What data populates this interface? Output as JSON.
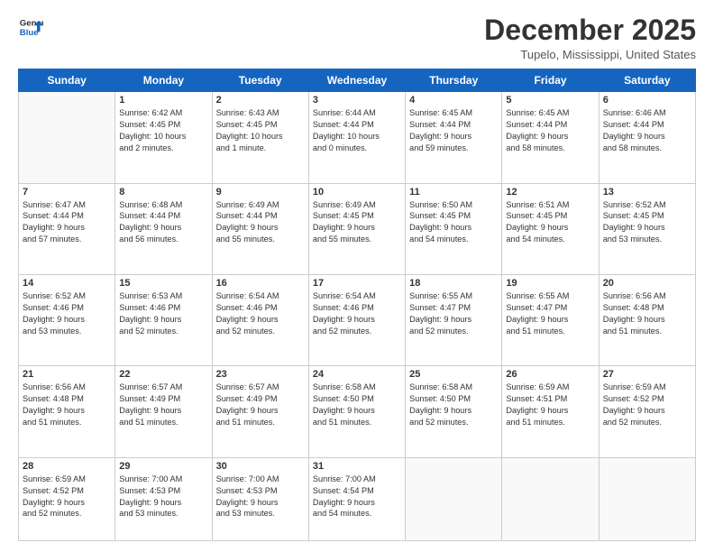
{
  "header": {
    "logo_line1": "General",
    "logo_line2": "Blue",
    "month_title": "December 2025",
    "location": "Tupelo, Mississippi, United States"
  },
  "weekdays": [
    "Sunday",
    "Monday",
    "Tuesday",
    "Wednesday",
    "Thursday",
    "Friday",
    "Saturday"
  ],
  "weeks": [
    [
      {
        "day": "",
        "info": ""
      },
      {
        "day": "1",
        "info": "Sunrise: 6:42 AM\nSunset: 4:45 PM\nDaylight: 10 hours\nand 2 minutes."
      },
      {
        "day": "2",
        "info": "Sunrise: 6:43 AM\nSunset: 4:45 PM\nDaylight: 10 hours\nand 1 minute."
      },
      {
        "day": "3",
        "info": "Sunrise: 6:44 AM\nSunset: 4:44 PM\nDaylight: 10 hours\nand 0 minutes."
      },
      {
        "day": "4",
        "info": "Sunrise: 6:45 AM\nSunset: 4:44 PM\nDaylight: 9 hours\nand 59 minutes."
      },
      {
        "day": "5",
        "info": "Sunrise: 6:45 AM\nSunset: 4:44 PM\nDaylight: 9 hours\nand 58 minutes."
      },
      {
        "day": "6",
        "info": "Sunrise: 6:46 AM\nSunset: 4:44 PM\nDaylight: 9 hours\nand 58 minutes."
      }
    ],
    [
      {
        "day": "7",
        "info": "Sunrise: 6:47 AM\nSunset: 4:44 PM\nDaylight: 9 hours\nand 57 minutes."
      },
      {
        "day": "8",
        "info": "Sunrise: 6:48 AM\nSunset: 4:44 PM\nDaylight: 9 hours\nand 56 minutes."
      },
      {
        "day": "9",
        "info": "Sunrise: 6:49 AM\nSunset: 4:44 PM\nDaylight: 9 hours\nand 55 minutes."
      },
      {
        "day": "10",
        "info": "Sunrise: 6:49 AM\nSunset: 4:45 PM\nDaylight: 9 hours\nand 55 minutes."
      },
      {
        "day": "11",
        "info": "Sunrise: 6:50 AM\nSunset: 4:45 PM\nDaylight: 9 hours\nand 54 minutes."
      },
      {
        "day": "12",
        "info": "Sunrise: 6:51 AM\nSunset: 4:45 PM\nDaylight: 9 hours\nand 54 minutes."
      },
      {
        "day": "13",
        "info": "Sunrise: 6:52 AM\nSunset: 4:45 PM\nDaylight: 9 hours\nand 53 minutes."
      }
    ],
    [
      {
        "day": "14",
        "info": "Sunrise: 6:52 AM\nSunset: 4:46 PM\nDaylight: 9 hours\nand 53 minutes."
      },
      {
        "day": "15",
        "info": "Sunrise: 6:53 AM\nSunset: 4:46 PM\nDaylight: 9 hours\nand 52 minutes."
      },
      {
        "day": "16",
        "info": "Sunrise: 6:54 AM\nSunset: 4:46 PM\nDaylight: 9 hours\nand 52 minutes."
      },
      {
        "day": "17",
        "info": "Sunrise: 6:54 AM\nSunset: 4:46 PM\nDaylight: 9 hours\nand 52 minutes."
      },
      {
        "day": "18",
        "info": "Sunrise: 6:55 AM\nSunset: 4:47 PM\nDaylight: 9 hours\nand 52 minutes."
      },
      {
        "day": "19",
        "info": "Sunrise: 6:55 AM\nSunset: 4:47 PM\nDaylight: 9 hours\nand 51 minutes."
      },
      {
        "day": "20",
        "info": "Sunrise: 6:56 AM\nSunset: 4:48 PM\nDaylight: 9 hours\nand 51 minutes."
      }
    ],
    [
      {
        "day": "21",
        "info": "Sunrise: 6:56 AM\nSunset: 4:48 PM\nDaylight: 9 hours\nand 51 minutes."
      },
      {
        "day": "22",
        "info": "Sunrise: 6:57 AM\nSunset: 4:49 PM\nDaylight: 9 hours\nand 51 minutes."
      },
      {
        "day": "23",
        "info": "Sunrise: 6:57 AM\nSunset: 4:49 PM\nDaylight: 9 hours\nand 51 minutes."
      },
      {
        "day": "24",
        "info": "Sunrise: 6:58 AM\nSunset: 4:50 PM\nDaylight: 9 hours\nand 51 minutes."
      },
      {
        "day": "25",
        "info": "Sunrise: 6:58 AM\nSunset: 4:50 PM\nDaylight: 9 hours\nand 52 minutes."
      },
      {
        "day": "26",
        "info": "Sunrise: 6:59 AM\nSunset: 4:51 PM\nDaylight: 9 hours\nand 51 minutes."
      },
      {
        "day": "27",
        "info": "Sunrise: 6:59 AM\nSunset: 4:52 PM\nDaylight: 9 hours\nand 52 minutes."
      }
    ],
    [
      {
        "day": "28",
        "info": "Sunrise: 6:59 AM\nSunset: 4:52 PM\nDaylight: 9 hours\nand 52 minutes."
      },
      {
        "day": "29",
        "info": "Sunrise: 7:00 AM\nSunset: 4:53 PM\nDaylight: 9 hours\nand 53 minutes."
      },
      {
        "day": "30",
        "info": "Sunrise: 7:00 AM\nSunset: 4:53 PM\nDaylight: 9 hours\nand 53 minutes."
      },
      {
        "day": "31",
        "info": "Sunrise: 7:00 AM\nSunset: 4:54 PM\nDaylight: 9 hours\nand 54 minutes."
      },
      {
        "day": "",
        "info": ""
      },
      {
        "day": "",
        "info": ""
      },
      {
        "day": "",
        "info": ""
      }
    ]
  ]
}
